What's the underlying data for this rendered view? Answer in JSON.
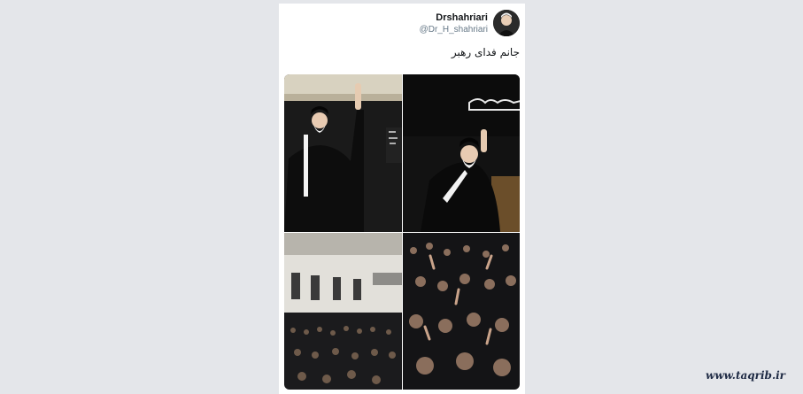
{
  "tweet": {
    "display_name": "Drshahriari",
    "handle": "@Dr_H_shahriari",
    "text": "جانم فدای رهبر",
    "photos": [
      {
        "name": "photo-leader-waving-1"
      },
      {
        "name": "photo-leader-seated-waving"
      },
      {
        "name": "photo-hall-interior"
      },
      {
        "name": "photo-crowd"
      }
    ]
  },
  "watermark": "www.taqrib.ir",
  "colors": {
    "background": "#e4e6ea",
    "card": "#ffffff",
    "text": "#14171a",
    "handle": "#657786"
  }
}
